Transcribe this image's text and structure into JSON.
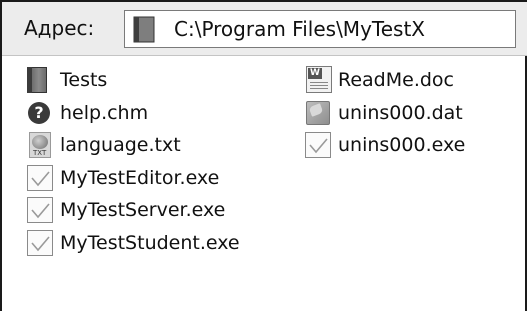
{
  "address_bar": {
    "label": "Адрес:",
    "path": "C:\\Program Files\\MyTestX"
  },
  "files": [
    {
      "name": "Tests",
      "icon": "folder-icon",
      "col": 0,
      "row": 0
    },
    {
      "name": "help.chm",
      "icon": "help-icon",
      "col": 0,
      "row": 1
    },
    {
      "name": "language.txt",
      "icon": "text-file-icon",
      "col": 0,
      "row": 2
    },
    {
      "name": "MyTestEditor.exe",
      "icon": "exe-icon",
      "col": 0,
      "row": 3
    },
    {
      "name": "MyTestServer.exe",
      "icon": "exe-icon",
      "col": 0,
      "row": 4
    },
    {
      "name": "MyTestStudent.exe",
      "icon": "exe-icon",
      "col": 0,
      "row": 5
    },
    {
      "name": "ReadMe.doc",
      "icon": "word-doc-icon",
      "col": 1,
      "row": 0
    },
    {
      "name": "unins000.dat",
      "icon": "dat-file-icon",
      "col": 1,
      "row": 1
    },
    {
      "name": "unins000.exe",
      "icon": "exe-icon",
      "col": 1,
      "row": 2
    }
  ]
}
